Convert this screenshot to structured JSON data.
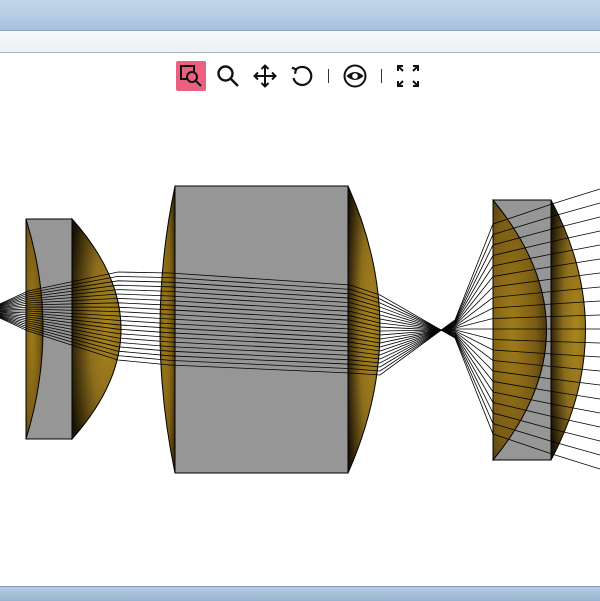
{
  "toolbar": {
    "tools": [
      {
        "name": "zoom-to-rectangle",
        "icon": "zoom-box-icon",
        "active": true
      },
      {
        "name": "zoom",
        "icon": "magnifier-icon",
        "active": false
      },
      {
        "name": "pan",
        "icon": "move-arrows-icon",
        "active": false
      },
      {
        "name": "reset-view",
        "icon": "rotate-ccw-icon",
        "active": false
      },
      {
        "name": "toggle-visibility",
        "icon": "eye-icon",
        "active": false
      },
      {
        "name": "fullscreen",
        "icon": "fullscreen-icon",
        "active": false
      }
    ],
    "active_color": "#e9617f"
  },
  "scene": {
    "lens_material_color": "#8c6d1c",
    "element_body_color": "#969696",
    "ray_color": "#000000",
    "background_color": "#ffffff",
    "lens_elements": 4
  }
}
